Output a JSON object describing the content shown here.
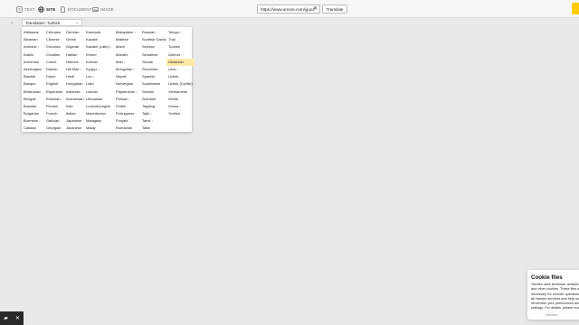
{
  "header": {
    "modes": [
      {
        "label": "TEXT",
        "icon": "text-icon"
      },
      {
        "label": "SITE",
        "icon": "globe-icon"
      },
      {
        "label": "DOCUMENT",
        "icon": "document-icon"
      },
      {
        "label": "IMAGE",
        "icon": "image-icon"
      }
    ],
    "active_mode": "SITE",
    "url_value": "https://www.amore.com/yjuoz-ex",
    "translate_label": "Translate"
  },
  "target_select": {
    "value": "Translation: Turkish"
  },
  "language_columns": [
    [
      {
        "label": "Afrikaans"
      },
      {
        "label": "Albanian"
      },
      {
        "label": "Amharic",
        "voice": true
      },
      {
        "label": "Arabic"
      },
      {
        "label": "Armenian"
      },
      {
        "label": "Azerbaijani"
      },
      {
        "label": "Bashkir"
      },
      {
        "label": "Basque"
      },
      {
        "label": "Belarusian"
      },
      {
        "label": "Bengali"
      },
      {
        "label": "Bosnian"
      },
      {
        "label": "Bulgarian"
      },
      {
        "label": "Burmese",
        "voice": true
      },
      {
        "label": "Catalan"
      }
    ],
    [
      {
        "label": "Cebuano"
      },
      {
        "label": "Chinese"
      },
      {
        "label": "Chuvash"
      },
      {
        "label": "Croatian"
      },
      {
        "label": "Czech"
      },
      {
        "label": "Danish"
      },
      {
        "label": "Dutch"
      },
      {
        "label": "English"
      },
      {
        "label": "Esperanto"
      },
      {
        "label": "Estonian"
      },
      {
        "label": "Finnish"
      },
      {
        "label": "French"
      },
      {
        "label": "Galician"
      },
      {
        "label": "Georgian"
      }
    ],
    [
      {
        "label": "German"
      },
      {
        "label": "Greek"
      },
      {
        "label": "Gujarati"
      },
      {
        "label": "Haitian"
      },
      {
        "label": "Hebrew"
      },
      {
        "label": "Hill Mari",
        "voice": true
      },
      {
        "label": "Hindi"
      },
      {
        "label": "Hungarian"
      },
      {
        "label": "Icelandic"
      },
      {
        "label": "Indonesian"
      },
      {
        "label": "Irish"
      },
      {
        "label": "Italian"
      },
      {
        "label": "Japanese"
      },
      {
        "label": "Javanese"
      }
    ],
    [
      {
        "label": "Kannada"
      },
      {
        "label": "Kazakh"
      },
      {
        "label": "Kazakh (Latin)",
        "voice": true
      },
      {
        "label": "Khmer"
      },
      {
        "label": "Korean"
      },
      {
        "label": "Kyrgyz",
        "voice": true
      },
      {
        "label": "Lao",
        "voice": true
      },
      {
        "label": "Latin"
      },
      {
        "label": "Latvian"
      },
      {
        "label": "Lithuanian"
      },
      {
        "label": "Luxembourgish"
      },
      {
        "label": "Macedonian"
      },
      {
        "label": "Malagasy"
      },
      {
        "label": "Malay"
      }
    ],
    [
      {
        "label": "Malayalam",
        "voice": true
      },
      {
        "label": "Maltese"
      },
      {
        "label": "Maori"
      },
      {
        "label": "Marathi"
      },
      {
        "label": "Mari",
        "voice": true
      },
      {
        "label": "Mongolian",
        "voice": true
      },
      {
        "label": "Nepali"
      },
      {
        "label": "Norwegian"
      },
      {
        "label": "Papiamento",
        "voice": true
      },
      {
        "label": "Persian"
      },
      {
        "label": "Polish"
      },
      {
        "label": "Portuguese"
      },
      {
        "label": "Punjabi"
      },
      {
        "label": "Romanian"
      }
    ],
    [
      {
        "label": "Russian"
      },
      {
        "label": "Scottish Gaelic"
      },
      {
        "label": "Serbian"
      },
      {
        "label": "Sinhalese"
      },
      {
        "label": "Slovak"
      },
      {
        "label": "Slovenian"
      },
      {
        "label": "Spanish"
      },
      {
        "label": "Sundanese"
      },
      {
        "label": "Swahili"
      },
      {
        "label": "Swedish"
      },
      {
        "label": "Tagalog"
      },
      {
        "label": "Tajik",
        "voice": true
      },
      {
        "label": "Tamil",
        "voice": true
      },
      {
        "label": "Tatar"
      }
    ],
    [
      {
        "label": "Telugu",
        "voice": true
      },
      {
        "label": "Thai"
      },
      {
        "label": "Turkish"
      },
      {
        "label": "Udmurt",
        "voice": true
      },
      {
        "label": "Ukrainian"
      },
      {
        "label": "Urdu"
      },
      {
        "label": "Uzbek"
      },
      {
        "label": "Uzbek (Cyrillic)"
      },
      {
        "label": "Vietnamese"
      },
      {
        "label": "Welsh"
      },
      {
        "label": "Xhosa",
        "voice": true
      },
      {
        "label": "Yiddish"
      }
    ]
  ],
  "selected_language": "Ukrainian",
  "cookie": {
    "title": "Cookie files",
    "body": "Yandex uses technical, analytical and other cookies. These files are necessary for smooth operation of all Yandex services and help us remember your preferences and settings. For details, please read",
    "decline_label": "Decline"
  },
  "colors": {
    "accent": "#ffcc00",
    "selected_bg": "#ffe9a8",
    "page_bg": "#e9e9e9"
  }
}
